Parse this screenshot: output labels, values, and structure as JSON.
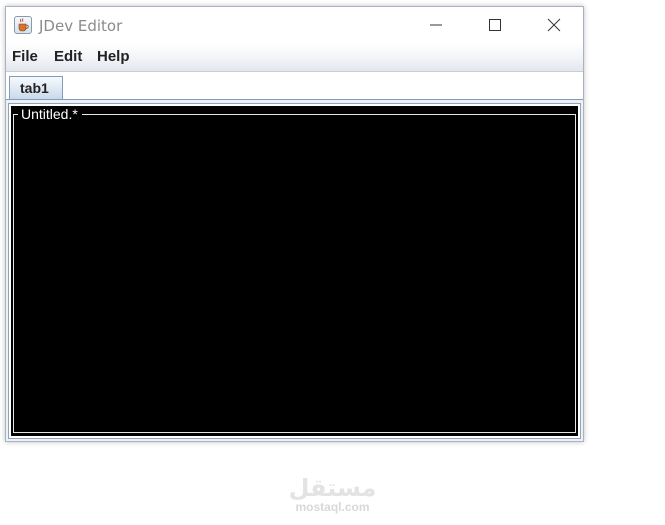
{
  "window": {
    "title": "JDev Editor"
  },
  "menubar": {
    "items": [
      {
        "label": "File"
      },
      {
        "label": "Edit"
      },
      {
        "label": "Help"
      }
    ]
  },
  "tabs": [
    {
      "label": "tab1",
      "active": true
    }
  ],
  "editor": {
    "document_title": "Untitled.*",
    "content": "",
    "background": "#000000",
    "foreground": "#ffffff"
  },
  "watermark": {
    "arabic": "مستقل",
    "latin": "mostaql.com"
  },
  "colors": {
    "tab_border": "#7f9db9",
    "tab_fill": "#c9d9ea"
  }
}
